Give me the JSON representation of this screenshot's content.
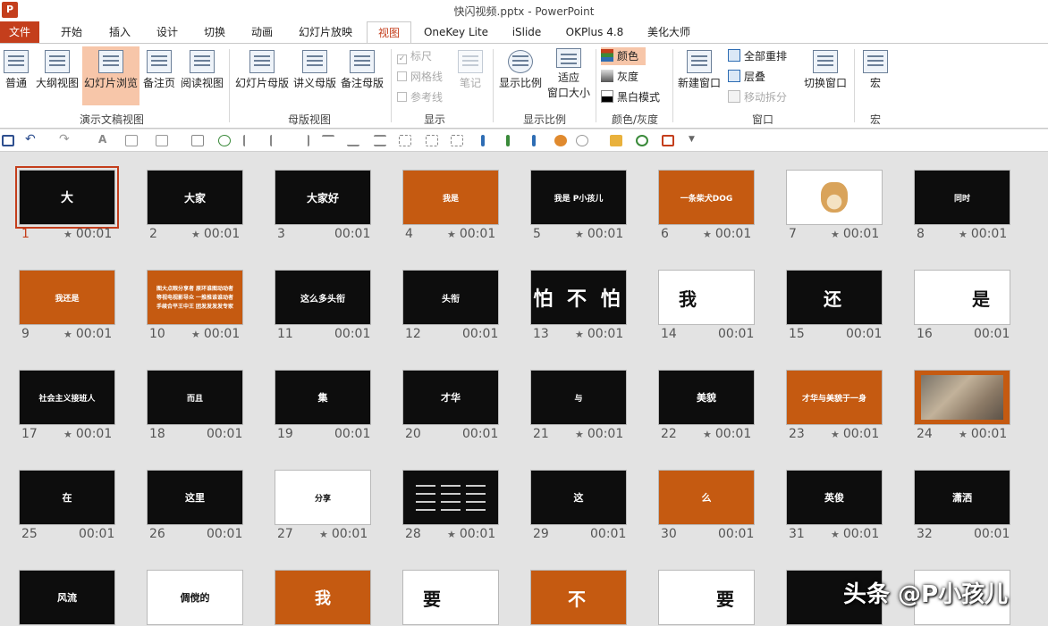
{
  "window": {
    "title": "快闪视频.pptx - PowerPoint",
    "logo": "P"
  },
  "tabs": [
    "文件",
    "开始",
    "插入",
    "设计",
    "切换",
    "动画",
    "幻灯片放映",
    "视图",
    "OneKey Lite",
    "iSlide",
    "OKPlus 4.8",
    "美化大师"
  ],
  "ribbon": {
    "buttons": [
      "普通",
      "大纲视图",
      "幻灯片浏览",
      "备注页",
      "阅读视图",
      "幻灯片母版",
      "讲义母版",
      "备注母版",
      "笔记",
      "显示比例",
      "适应",
      "窗口大小",
      "新建窗口",
      "切换窗口",
      "宏"
    ],
    "show": [
      "标尺",
      "网格线",
      "参考线"
    ],
    "color": [
      "颜色",
      "灰度",
      "黑白模式"
    ],
    "window_cmds": [
      "全部重排",
      "层叠",
      "移动拆分"
    ],
    "groups": [
      "演示文稿视图",
      "母版视图",
      "显示",
      "显示比例",
      "颜色/灰度",
      "窗口",
      "宏"
    ],
    "colors": {
      "accent": "#c43e1c",
      "orange": "#c55a11",
      "dark": "#0d0d0d"
    }
  },
  "slides": [
    {
      "n": "1",
      "text": "大",
      "color": "dark",
      "star": true,
      "time": "00:01",
      "fs": 14
    },
    {
      "n": "2",
      "text": "大家",
      "color": "dark",
      "star": true,
      "time": "00:01",
      "fs": 12
    },
    {
      "n": "3",
      "text": "大家好",
      "color": "dark",
      "star": false,
      "time": "00:01",
      "fs": 12
    },
    {
      "n": "4",
      "text": "我是",
      "color": "orange",
      "star": true,
      "time": "00:01",
      "fs": 9
    },
    {
      "n": "5",
      "text": "我是 P小孩儿",
      "color": "dark",
      "star": true,
      "time": "00:01",
      "fs": 9
    },
    {
      "n": "6",
      "text": "一条柴犬DOG",
      "color": "orange",
      "star": true,
      "time": "00:01",
      "fs": 9
    },
    {
      "n": "7",
      "text": "",
      "color": "white",
      "star": true,
      "time": "00:01",
      "fs": 9,
      "img": "doge"
    },
    {
      "n": "8",
      "text": "同时",
      "color": "dark",
      "star": true,
      "time": "00:01",
      "fs": 9
    },
    {
      "n": "9",
      "text": "我还是",
      "color": "orange",
      "star": true,
      "time": "00:01",
      "fs": 9
    },
    {
      "n": "10",
      "text": "",
      "color": "orange",
      "star": true,
      "time": "00:01",
      "fs": 6,
      "lines": [
        "图大点眼分享者 原环谁图动动者",
        "等视电视影导众 一推推谁谁动者",
        "手续合平王中王 团发发发发专家"
      ]
    },
    {
      "n": "11",
      "text": "这么多头衔",
      "color": "dark",
      "star": false,
      "time": "00:01",
      "fs": 10
    },
    {
      "n": "12",
      "text": "头衔",
      "color": "dark",
      "star": false,
      "time": "00:01",
      "fs": 10
    },
    {
      "n": "13",
      "text": "怕 不 怕",
      "color": "dark",
      "star": true,
      "time": "00:01",
      "fs": 22
    },
    {
      "n": "14",
      "text": "我",
      "color": "white",
      "star": false,
      "time": "00:01",
      "fs": 20,
      "align": "left"
    },
    {
      "n": "15",
      "text": "还",
      "color": "dark",
      "star": false,
      "time": "00:01",
      "fs": 20
    },
    {
      "n": "16",
      "text": "是",
      "color": "white",
      "star": false,
      "time": "00:01",
      "fs": 20,
      "align": "right"
    },
    {
      "n": "17",
      "text": "社会主义接班人",
      "color": "dark",
      "star": true,
      "time": "00:01",
      "fs": 9
    },
    {
      "n": "18",
      "text": "而且",
      "color": "dark",
      "star": false,
      "time": "00:01",
      "fs": 9
    },
    {
      "n": "19",
      "text": "集",
      "color": "dark",
      "star": false,
      "time": "00:01",
      "fs": 11
    },
    {
      "n": "20",
      "text": "才华",
      "color": "dark",
      "star": false,
      "time": "00:01",
      "fs": 11
    },
    {
      "n": "21",
      "text": "与",
      "color": "dark",
      "star": true,
      "time": "00:01",
      "fs": 9
    },
    {
      "n": "22",
      "text": "美貌",
      "color": "dark",
      "star": true,
      "time": "00:01",
      "fs": 11
    },
    {
      "n": "23",
      "text": "才华与美貌于一身",
      "color": "orange",
      "star": true,
      "time": "00:01",
      "fs": 9
    },
    {
      "n": "24",
      "text": "",
      "color": "orange",
      "star": true,
      "time": "00:01",
      "fs": 9,
      "img": "child"
    },
    {
      "n": "25",
      "text": "在",
      "color": "dark",
      "star": false,
      "time": "00:01",
      "fs": 11
    },
    {
      "n": "26",
      "text": "这里",
      "color": "dark",
      "star": false,
      "time": "00:01",
      "fs": 11
    },
    {
      "n": "27",
      "text": "分享",
      "color": "white",
      "star": true,
      "time": "00:01",
      "fs": 9
    },
    {
      "n": "28",
      "text": "",
      "color": "dark",
      "star": true,
      "time": "00:01",
      "fs": 5,
      "grid": true
    },
    {
      "n": "29",
      "text": "这",
      "color": "dark",
      "star": false,
      "time": "00:01",
      "fs": 11
    },
    {
      "n": "30",
      "text": "么",
      "color": "orange",
      "star": false,
      "time": "00:01",
      "fs": 11
    },
    {
      "n": "31",
      "text": "英俊",
      "color": "dark",
      "star": true,
      "time": "00:01",
      "fs": 11
    },
    {
      "n": "32",
      "text": "潇洒",
      "color": "dark",
      "star": false,
      "time": "00:01",
      "fs": 11
    },
    {
      "n": "",
      "text": "风流",
      "color": "dark",
      "star": false,
      "time": "",
      "fs": 11
    },
    {
      "n": "",
      "text": "倜傥的",
      "color": "white",
      "star": false,
      "time": "",
      "fs": 11
    },
    {
      "n": "",
      "text": "我",
      "color": "orange",
      "star": false,
      "time": "",
      "fs": 18
    },
    {
      "n": "",
      "text": "要",
      "color": "white",
      "star": false,
      "time": "",
      "fs": 20,
      "align": "left"
    },
    {
      "n": "",
      "text": "不",
      "color": "orange",
      "star": false,
      "time": "",
      "fs": 20
    },
    {
      "n": "",
      "text": "要",
      "color": "white",
      "star": false,
      "time": "",
      "fs": 20,
      "align": "right"
    },
    {
      "n": "",
      "text": "",
      "color": "dark",
      "star": false,
      "time": "",
      "fs": 11
    },
    {
      "n": "",
      "text": "",
      "color": "white",
      "star": false,
      "time": "",
      "fs": 11
    }
  ],
  "watermark": "头条 @P小孩儿"
}
